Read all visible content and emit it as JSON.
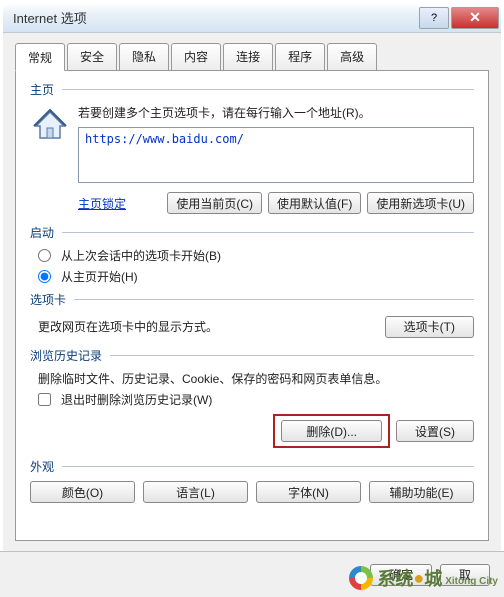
{
  "window": {
    "title": "Internet 选项"
  },
  "tabs": [
    "常规",
    "安全",
    "隐私",
    "内容",
    "连接",
    "程序",
    "高级"
  ],
  "active_tab": 0,
  "sections": {
    "homepage": {
      "label": "主页",
      "desc": "若要创建多个主页选项卡，请在每行输入一个地址(R)。",
      "url": "https://www.baidu.com/",
      "lock_link": "主页锁定",
      "btn_current": "使用当前页(C)",
      "btn_default": "使用默认值(F)",
      "btn_newtab": "使用新选项卡(U)"
    },
    "startup": {
      "label": "启动",
      "radio_last": "从上次会话中的选项卡开始(B)",
      "radio_home": "从主页开始(H)"
    },
    "tabsopt": {
      "label": "选项卡",
      "desc": "更改网页在选项卡中的显示方式。",
      "btn": "选项卡(T)"
    },
    "history": {
      "label": "浏览历史记录",
      "desc": "删除临时文件、历史记录、Cookie、保存的密码和网页表单信息。",
      "check_delete_on_exit": "退出时删除浏览历史记录(W)",
      "btn_delete": "删除(D)...",
      "btn_settings": "设置(S)"
    },
    "appearance": {
      "label": "外观",
      "btn_colors": "颜色(O)",
      "btn_lang": "语言(L)",
      "btn_fonts": "字体(N)",
      "btn_access": "辅助功能(E)"
    }
  },
  "footer": {
    "ok": "确定",
    "cancel": "取"
  },
  "watermark": {
    "cn": "系统",
    "dot": "●",
    "en": "城",
    "sub": "Xitong City"
  }
}
